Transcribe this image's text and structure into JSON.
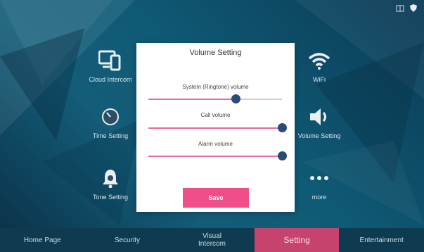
{
  "top_bar": {
    "icons": [
      "window-icon",
      "shield-icon"
    ]
  },
  "apps": [
    {
      "label": "Cloud Intercom",
      "icon": "cloud-intercom-icon"
    },
    {
      "label": "WiFi",
      "icon": "wifi-icon"
    },
    {
      "label": "Time Setting",
      "icon": "clock-icon"
    },
    {
      "label": "Volume Setting",
      "icon": "speaker-icon"
    },
    {
      "label": "Tone Setting",
      "icon": "bell-icon"
    },
    {
      "label": "more",
      "icon": "ellipsis-icon"
    }
  ],
  "dialog": {
    "title": "Volume Setting",
    "sliders": [
      {
        "label": "System (Ringtone) volume",
        "value": 0.65
      },
      {
        "label": "Call volume",
        "value": 1.0
      },
      {
        "label": "Alarm volume",
        "value": 1.0
      }
    ],
    "save_label": "Save"
  },
  "tabs": [
    {
      "label": "Home Page"
    },
    {
      "label": "Security"
    },
    {
      "label": "Visual\nIntercom"
    },
    {
      "label": "Setting",
      "active": true
    },
    {
      "label": "Entertainment"
    }
  ],
  "colors": {
    "accent": "#f04e8a",
    "knob": "#2a4a7a",
    "active_tab": "#c6436e"
  }
}
